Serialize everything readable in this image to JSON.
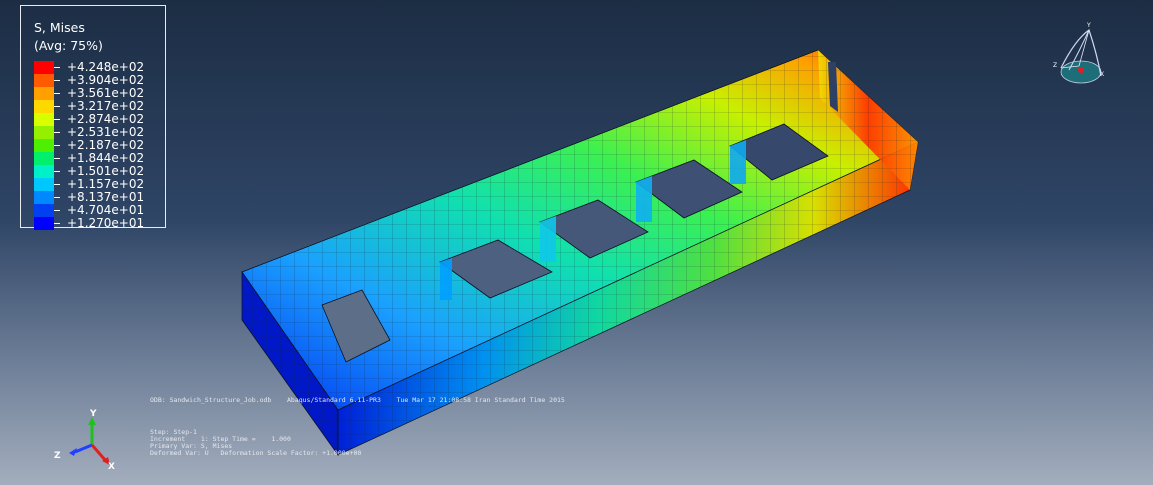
{
  "legend": {
    "title": "S, Mises",
    "subtitle": "(Avg: 75%)",
    "colors": [
      "#ff0000",
      "#ff5a00",
      "#ffa000",
      "#ffd800",
      "#d8ff00",
      "#94f000",
      "#4cf000",
      "#00f06c",
      "#00f0c8",
      "#00c8ff",
      "#0088ff",
      "#0040f0",
      "#0000ff"
    ],
    "values": [
      "+4.248e+02",
      "+3.904e+02",
      "+3.561e+02",
      "+3.217e+02",
      "+2.874e+02",
      "+2.531e+02",
      "+2.187e+02",
      "+1.844e+02",
      "+1.501e+02",
      "+1.157e+02",
      "+8.137e+01",
      "+4.704e+01",
      "+1.270e+01"
    ]
  },
  "info": {
    "odb_line": "ODB: Sandwich_Structure_Job.odb    Abaqus/Standard 6.11-PR3    Tue Mar 17 21:08:58 Iran Standard Time 2015",
    "step": "Step: Step-1",
    "increment": "Increment    1: Step Time =    1.000",
    "primary_var": "Primary Var: S, Mises",
    "deformed_var": "Deformed Var: U   Deformation Scale Factor: +1.000e+00"
  },
  "triad": {
    "y": "Y",
    "z": "Z",
    "x": "X"
  },
  "view_triad": {
    "y": "Y",
    "z": "Z",
    "x": "X"
  }
}
